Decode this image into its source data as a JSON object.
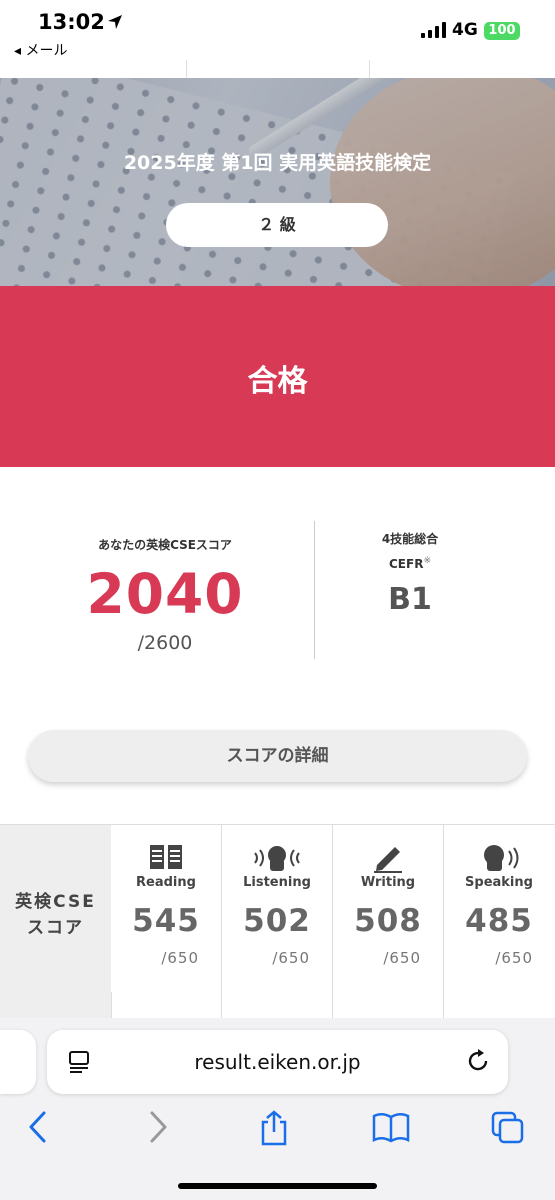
{
  "status_bar": {
    "time": "13:02",
    "back_label": "◂ メール",
    "network": "4G",
    "battery": "100"
  },
  "hero": {
    "title": "2025年度 第1回 実用英語技能検定",
    "grade": "２ 級"
  },
  "result": {
    "label": "合格"
  },
  "score": {
    "label": "あなたの英検CSEスコア",
    "value": "2040",
    "max": "/2600",
    "cefr_title": "4技能総合",
    "cefr_label": "CEFR",
    "cefr_mark": "※",
    "cefr_value": "B1"
  },
  "detail_button": "スコアの詳細",
  "table": {
    "row_header_line1": "英検CSE",
    "row_header_line2": "スコア",
    "skills": [
      {
        "name": "Reading",
        "icon": "book-icon",
        "score": "545",
        "max": "/650"
      },
      {
        "name": "Listening",
        "icon": "listening-icon",
        "score": "502",
        "max": "/650"
      },
      {
        "name": "Writing",
        "icon": "pencil-icon",
        "score": "508",
        "max": "/650"
      },
      {
        "name": "Speaking",
        "icon": "speaking-icon",
        "score": "485",
        "max": "/650"
      }
    ]
  },
  "browser": {
    "url": "result.eiken.or.jp"
  },
  "colors": {
    "accent": "#d83a55",
    "ios_blue": "#1a6fe8"
  }
}
